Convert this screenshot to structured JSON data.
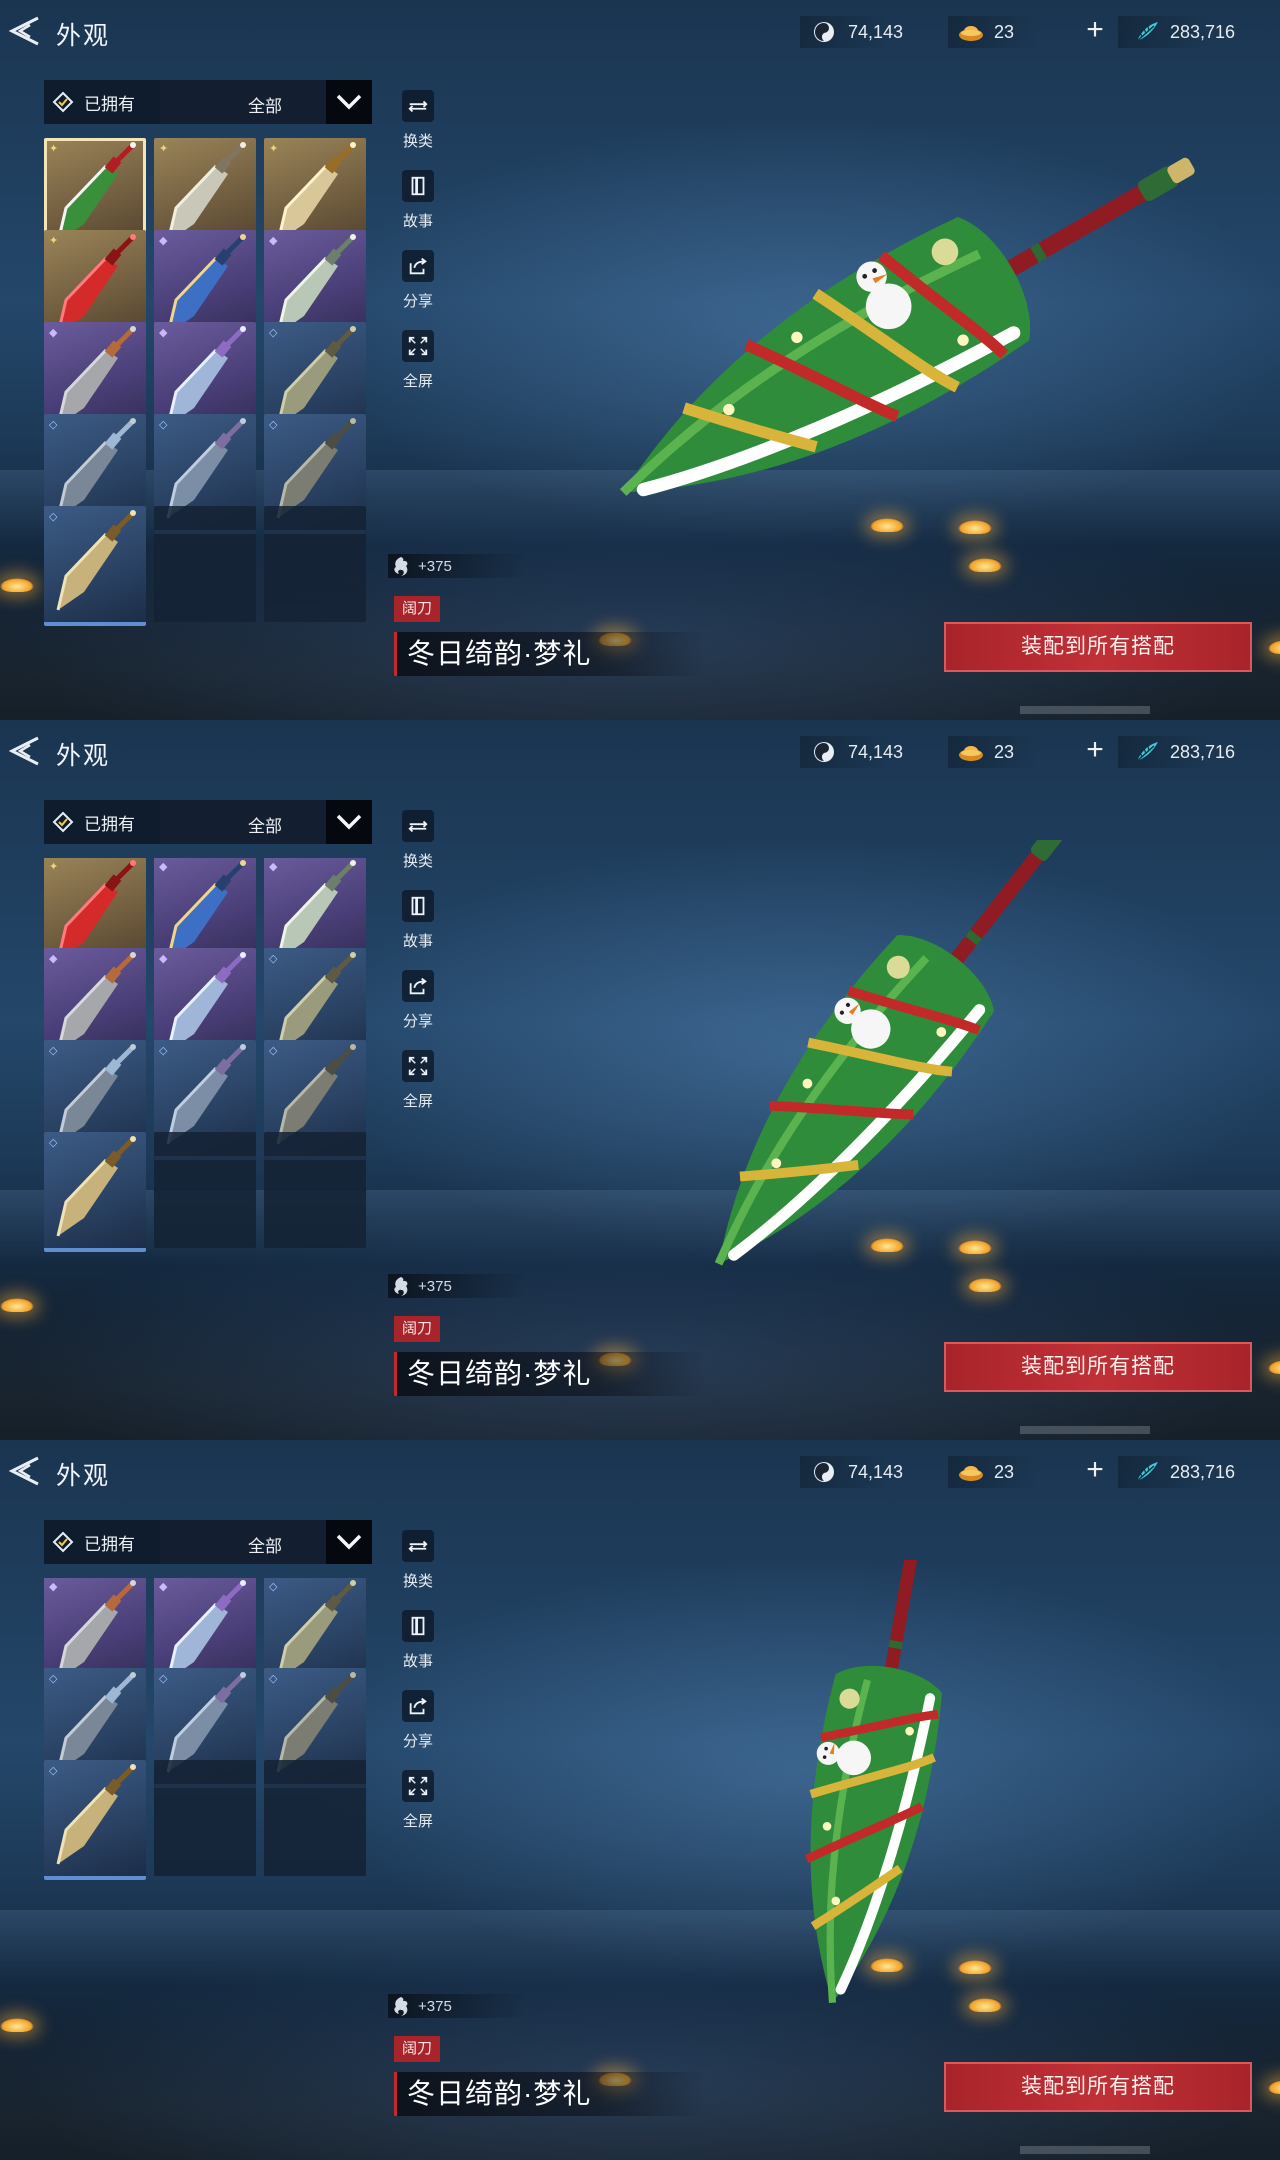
{
  "header": {
    "title": "外观"
  },
  "currencies": [
    {
      "icon": "jade-swirl-icon",
      "value": "74,143"
    },
    {
      "icon": "gold-ingot-icon",
      "value": "23"
    },
    {
      "icon": "feather-coin-icon",
      "value": "283,716"
    }
  ],
  "filter": {
    "owned_label": "已拥有",
    "category_label": "全部"
  },
  "side_buttons": [
    {
      "icon": "weapon-swap-icon",
      "label": "换类"
    },
    {
      "icon": "story-book-icon",
      "label": "故事"
    },
    {
      "icon": "share-icon",
      "label": "分享"
    },
    {
      "icon": "fullscreen-icon",
      "label": "全屏"
    }
  ],
  "item": {
    "power": "+375",
    "type_tag": "阔刀",
    "name": "冬日绮韵·梦礼"
  },
  "equip_label": "装配到所有搭配",
  "grid_items": [
    {
      "rarity": "gold",
      "variant": "xmas",
      "selected": true
    },
    {
      "rarity": "gold",
      "variant": "silver"
    },
    {
      "rarity": "gold",
      "variant": "goldwing"
    },
    {
      "rarity": "gold",
      "variant": "red"
    },
    {
      "rarity": "purple",
      "variant": "bluefin"
    },
    {
      "rarity": "purple",
      "variant": "pale"
    },
    {
      "rarity": "purple",
      "variant": "bronze"
    },
    {
      "rarity": "purple",
      "variant": "violet"
    },
    {
      "rarity": "blue",
      "variant": "olive"
    },
    {
      "rarity": "blue",
      "variant": "steel"
    },
    {
      "rarity": "blue",
      "variant": "slate"
    },
    {
      "rarity": "blue",
      "variant": "gray"
    },
    {
      "rarity": "blue",
      "variant": "brass"
    }
  ]
}
